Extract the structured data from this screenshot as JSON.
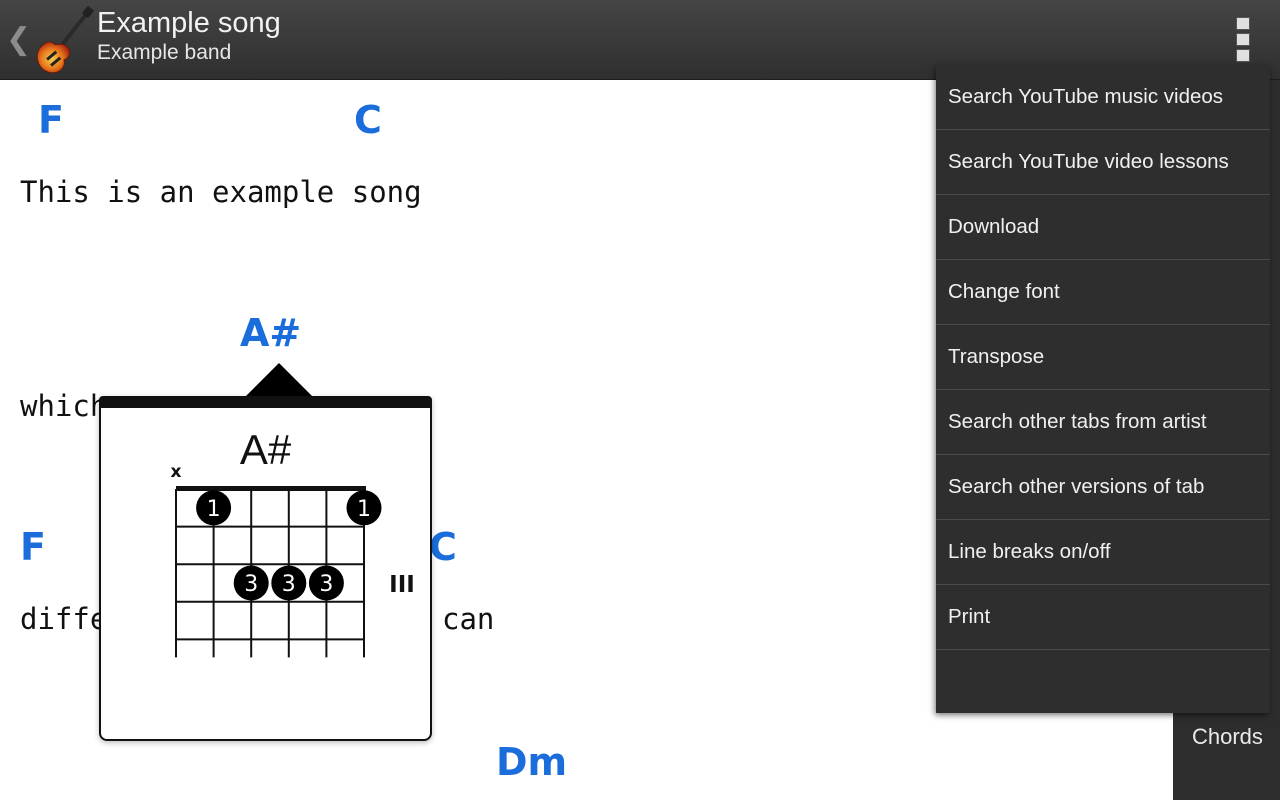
{
  "actionbar": {
    "up_icon": "chevron-left-icon",
    "app_icon": "electric-guitar-icon",
    "title": "Example song",
    "subtitle": "Example band",
    "overflow_icon": "overflow-menu-icon"
  },
  "song": {
    "chords": [
      {
        "id": "f1",
        "name": "F"
      },
      {
        "id": "c1",
        "name": "C"
      },
      {
        "id": "as1",
        "name": "A#"
      },
      {
        "id": "f2",
        "name": "F"
      },
      {
        "id": "c2",
        "name": "C"
      },
      {
        "id": "dm1",
        "name": "Dm"
      }
    ],
    "lyrics": [
      "This is an example song",
      "which",
      "diffe",
      "can"
    ],
    "chord_color": "#1a6ddb"
  },
  "chord_popup": {
    "name": "A#",
    "muted_strings_marker": "x",
    "fret_position_label": "III",
    "fingers": [
      {
        "string": 2,
        "fret": 1,
        "finger": "1"
      },
      {
        "string": 6,
        "fret": 1,
        "finger": "1"
      },
      {
        "string": 3,
        "fret": 3,
        "finger": "3"
      },
      {
        "string": 4,
        "fret": 3,
        "finger": "3"
      },
      {
        "string": 5,
        "fret": 3,
        "finger": "3"
      }
    ],
    "muted_string": 1
  },
  "side_panel": {
    "chords_label": "Chords"
  },
  "menu": {
    "items": [
      "Search YouTube music videos",
      "Search YouTube video lessons",
      "Download",
      "Change font",
      "Transpose",
      "Search other tabs from artist",
      "Search other versions of tab",
      "Line breaks on/off",
      "Print"
    ]
  }
}
